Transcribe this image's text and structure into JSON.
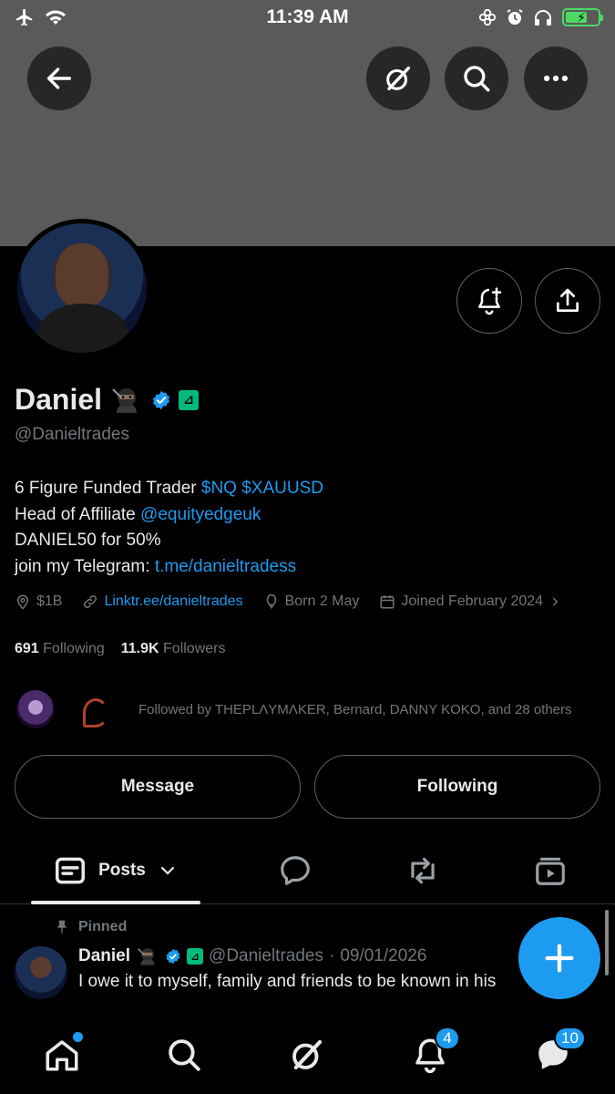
{
  "status_bar": {
    "time": "11:39 AM",
    "battery_color": "#4cd964"
  },
  "header": {
    "icons": [
      "back-arrow-icon",
      "grok-icon",
      "search-icon",
      "more-icon"
    ]
  },
  "profile": {
    "name": "Daniel",
    "handle": "@Danieltrades",
    "bio": {
      "line1_text": "6 Figure Funded Trader ",
      "line1_links": "$NQ $XAUUSD",
      "line2_text": "Head of Affiliate ",
      "line2_link": "@equityedgeuk",
      "line3_text": "DANIEL50 for 50%",
      "line4_text": "join my Telegram: ",
      "line4_link": "t.me/danieltradess"
    },
    "meta": {
      "location": "$1B",
      "website": "Linktr.ee/danieltrades",
      "birthday": "Born 2 May",
      "joined": "Joined February 2024"
    },
    "following_count": "691",
    "following_label": "Following",
    "followers_count": "11.9K",
    "followers_label": "Followers",
    "followed_by": "Followed by THEPLΛYMΛKER, Bernard, DANNY KOKO, and 28 others"
  },
  "actions": {
    "message_label": "Message",
    "following_label": "Following"
  },
  "tabs": {
    "posts_label": "Posts"
  },
  "pinned_post": {
    "pinned_label": "Pinned",
    "author_name": "Daniel",
    "author_handle": "@Danieltrades",
    "separator": "·",
    "date": "09/01/2026",
    "text": "I owe it to myself, family and friends to be known in his"
  },
  "bottom_nav": {
    "notifications_count": "4",
    "messages_count": "10"
  },
  "colors": {
    "accent": "#1d9bf0",
    "muted_text": "#71767b",
    "border": "#536471",
    "verified_badge": "#1d9bf0",
    "affiliate_badge": "#00ba7c"
  }
}
